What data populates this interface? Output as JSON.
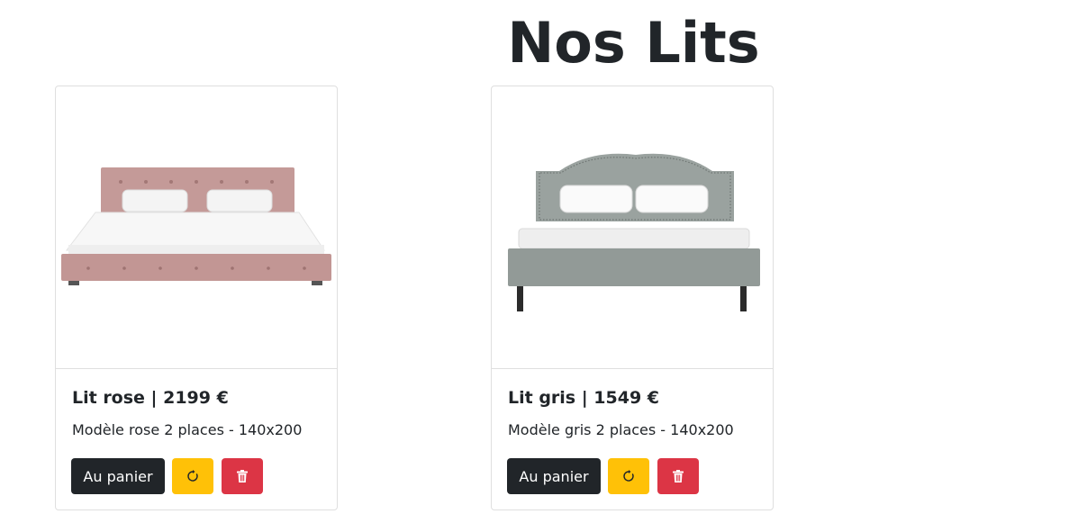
{
  "page": {
    "title": "Nos Lits"
  },
  "products": [
    {
      "title": "Lit rose | 2199 €",
      "description": "Modèle rose 2 places - 140x200",
      "image": "pink-upholstered-bed",
      "cart_label": "Au panier",
      "refresh_icon": "refresh-icon",
      "delete_icon": "trash-icon"
    },
    {
      "title": "Lit gris | 1549 €",
      "description": "Modèle gris 2 places - 140x200",
      "image": "gray-upholstered-bed",
      "cart_label": "Au panier",
      "refresh_icon": "refresh-icon",
      "delete_icon": "trash-icon"
    }
  ],
  "colors": {
    "dark_button": "#212529",
    "warning_button": "#ffc107",
    "danger_button": "#dc3545",
    "pink_bed": "#c49a98",
    "gray_bed": "#9aa29f"
  }
}
